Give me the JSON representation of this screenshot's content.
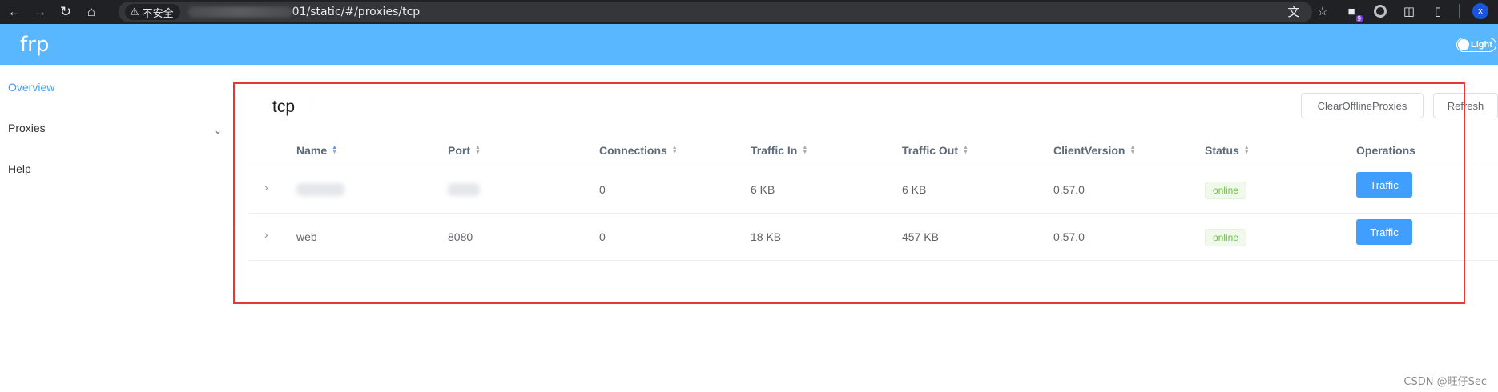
{
  "browser": {
    "security_label": "不安全",
    "url_visible": "01/static/#/proxies/tcp",
    "extension_badge": "9",
    "avatar_initial": "x"
  },
  "app": {
    "brand": "frp",
    "theme_label": "Light"
  },
  "sidebar": {
    "items": [
      {
        "label": "Overview",
        "active": true
      },
      {
        "label": "Proxies",
        "active": false,
        "expandable": true
      },
      {
        "label": "Help",
        "active": false
      }
    ]
  },
  "page": {
    "title": "tcp",
    "clear_button": "ClearOfflineProxies",
    "refresh_button": "Refresh"
  },
  "table": {
    "columns": [
      "Name",
      "Port",
      "Connections",
      "Traffic In",
      "Traffic Out",
      "ClientVersion",
      "Status",
      "Operations"
    ],
    "rows": [
      {
        "name": "",
        "port": "",
        "connections": "0",
        "traffic_in": "6 KB",
        "traffic_out": "6 KB",
        "client_version": "0.57.0",
        "status": "online",
        "operation": "Traffic"
      },
      {
        "name": "web",
        "port": "8080",
        "connections": "0",
        "traffic_in": "18 KB",
        "traffic_out": "457 KB",
        "client_version": "0.57.0",
        "status": "online",
        "operation": "Traffic"
      }
    ]
  },
  "colors": {
    "header_bg": "#58b7ff",
    "accent": "#409eff",
    "status_online": "#67c23a",
    "highlight_border": "#e53935"
  },
  "watermark": "CSDN @旺仔Sec"
}
